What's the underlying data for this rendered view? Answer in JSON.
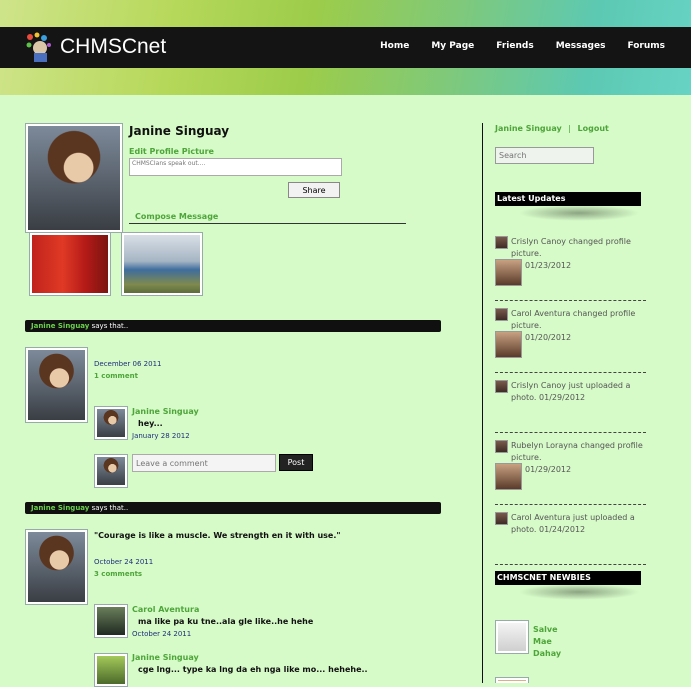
{
  "nav": {
    "site_name": "CHMSCnet",
    "links": [
      "Home",
      "My Page",
      "Friends",
      "Messages",
      "Forums"
    ]
  },
  "profile": {
    "name": "Janine Singuay",
    "edit_picture": "Edit Profile Picture",
    "status_placeholder": "CHMSCIans speak out....",
    "share": "Share",
    "compose": "Compose Message"
  },
  "posts": [
    {
      "author": "Janine Singuay",
      "says": "says that..",
      "date": "December 06 2011",
      "comments_count": "1 comment",
      "comments": [
        {
          "author": "Janine Singuay",
          "text": "hey...",
          "date": "January 28 2012"
        }
      ],
      "comment_placeholder": "Leave a comment",
      "post_label": "Post"
    },
    {
      "author": "Janine Singuay",
      "says": "says that..",
      "quote": "\"Courage is like a muscle. We strength en it with use.\"",
      "date": "October 24 2011",
      "comments_count": "3 comments",
      "comments": [
        {
          "author": "Carol Aventura",
          "text": "ma like pa ku tne..ala gle like..he hehe",
          "date": "October 24 2011"
        },
        {
          "author": "Janine Singuay",
          "text": "cge lng... type ka lng da eh nga like mo... hehehe.."
        }
      ]
    }
  ],
  "sidebar": {
    "user": "Janine Singuay",
    "separator": "|",
    "logout": "Logout",
    "search_placeholder": "Search",
    "latest_title": "Latest Updates",
    "updates": [
      {
        "text": "Crislyn Canoy changed profile picture.",
        "date": "01/23/2012"
      },
      {
        "text": "Carol Aventura changed profile picture.",
        "date": "01/20/2012"
      },
      {
        "text": "Crislyn Canoy just uploaded a photo. 01/29/2012"
      },
      {
        "text": "Rubelyn Lorayna changed profile picture.",
        "date": "01/29/2012"
      },
      {
        "text": "Carol Aventura just uploaded a photo. 01/24/2012"
      }
    ],
    "newbies_title": "CHMSCNET NEWBIES",
    "newbie": {
      "name1": "Salve",
      "name2": "Mae",
      "name3": "Dahay"
    }
  }
}
